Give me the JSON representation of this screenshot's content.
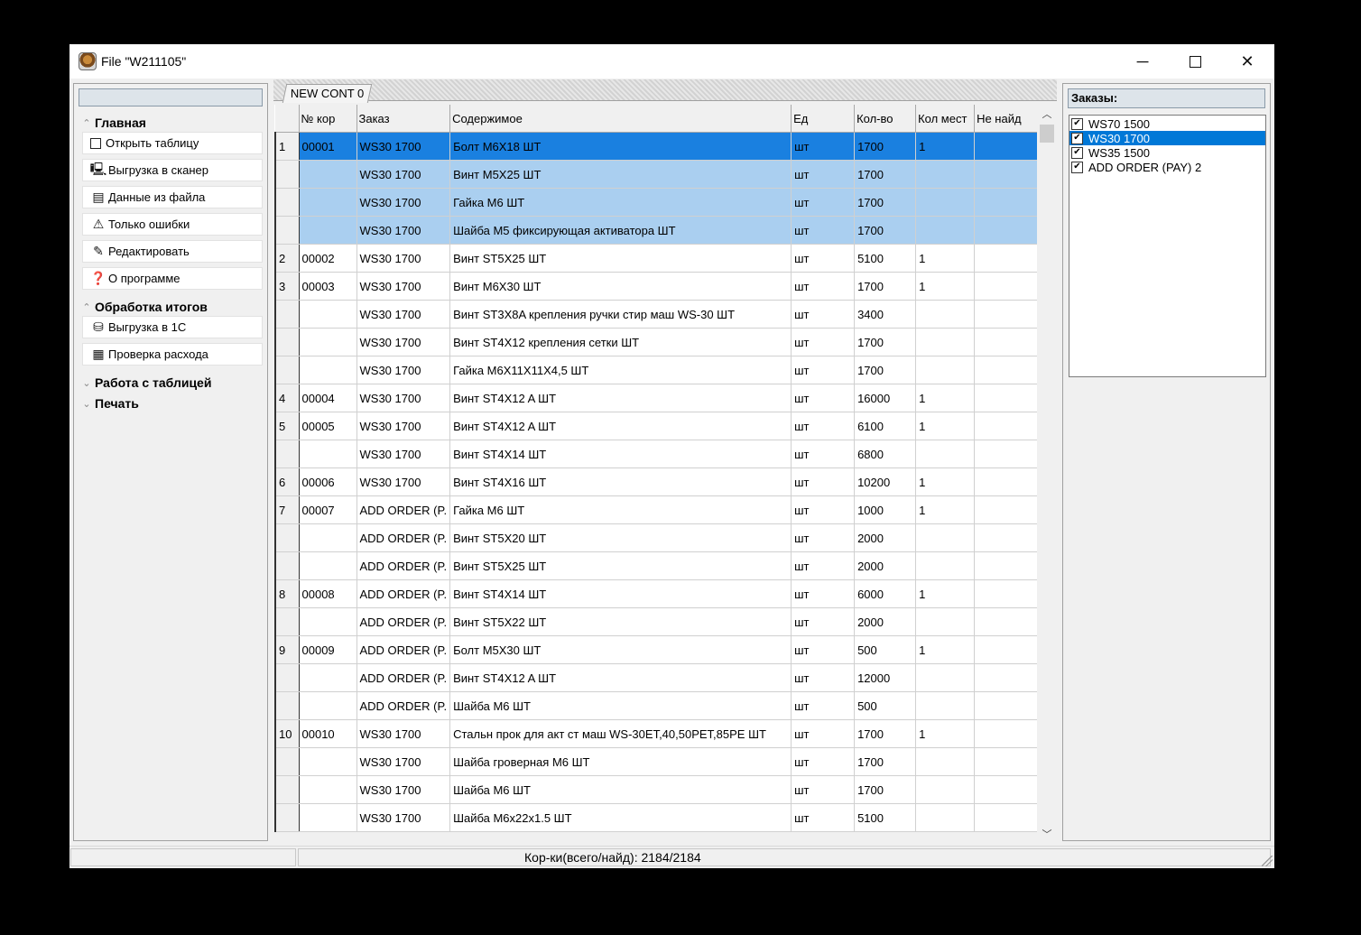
{
  "window": {
    "title": "File \"W211105\""
  },
  "left_panel": {
    "groups": [
      {
        "title": "Главная",
        "expanded": true,
        "items": [
          {
            "label": "Открыть таблицу",
            "icon": "table-open-icon"
          },
          {
            "label": "Выгрузка в сканер",
            "icon": "computer-export-icon"
          },
          {
            "label": "Данные из файла",
            "icon": "file-data-icon"
          },
          {
            "label": "Только ошибки",
            "icon": "warning-icon"
          },
          {
            "label": "Редактировать",
            "icon": "edit-icon"
          },
          {
            "label": "О программе",
            "icon": "help-icon"
          }
        ]
      },
      {
        "title": "Обработка итогов",
        "expanded": true,
        "items": [
          {
            "label": "Выгрузка в 1С",
            "icon": "1c-export-icon"
          },
          {
            "label": "Проверка расхода",
            "icon": "check-expense-icon"
          }
        ]
      },
      {
        "title": "Работа с таблицей",
        "expanded": false,
        "items": []
      },
      {
        "title": "Печать",
        "expanded": false,
        "items": []
      }
    ]
  },
  "grid": {
    "tab_label": "NEW CONT 0",
    "columns": [
      "№ кор",
      "Заказ",
      "Содержимое",
      "Ед",
      "Кол-во",
      "Кол мест",
      "Не найд"
    ],
    "rows": [
      {
        "ind": "1",
        "box": "00001",
        "order": "WS30 1700",
        "content": "Болт М6Х18 ШТ",
        "unit": "шт",
        "qty": "1700",
        "places": "1",
        "nf": "",
        "state": "sel"
      },
      {
        "ind": "",
        "box": "",
        "order": "WS30 1700",
        "content": "Винт М5Х25 ШТ",
        "unit": "шт",
        "qty": "1700",
        "places": "",
        "nf": "",
        "state": "sel2"
      },
      {
        "ind": "",
        "box": "",
        "order": "WS30 1700",
        "content": "Гайка М6 ШТ",
        "unit": "шт",
        "qty": "1700",
        "places": "",
        "nf": "",
        "state": "sel2"
      },
      {
        "ind": "",
        "box": "",
        "order": "WS30 1700",
        "content": "Шайба М5 фиксирующая активатора ШТ",
        "unit": "шт",
        "qty": "1700",
        "places": "",
        "nf": "",
        "state": "sel2"
      },
      {
        "ind": "2",
        "box": "00002",
        "order": "WS30 1700",
        "content": "Винт ST5X25 ШТ",
        "unit": "шт",
        "qty": "5100",
        "places": "1",
        "nf": "",
        "state": ""
      },
      {
        "ind": "3",
        "box": "00003",
        "order": "WS30 1700",
        "content": "Винт М6Х30 ШТ",
        "unit": "шт",
        "qty": "1700",
        "places": "1",
        "nf": "",
        "state": ""
      },
      {
        "ind": "",
        "box": "",
        "order": "WS30 1700",
        "content": "Винт ST3X8A крепления ручки стир маш WS-30 ШТ",
        "unit": "шт",
        "qty": "3400",
        "places": "",
        "nf": "",
        "state": ""
      },
      {
        "ind": "",
        "box": "",
        "order": "WS30 1700",
        "content": "Винт ST4X12 крепления сетки ШТ",
        "unit": "шт",
        "qty": "1700",
        "places": "",
        "nf": "",
        "state": ""
      },
      {
        "ind": "",
        "box": "",
        "order": "WS30 1700",
        "content": "Гайка М6Х11Х11Х4,5 ШТ",
        "unit": "шт",
        "qty": "1700",
        "places": "",
        "nf": "",
        "state": ""
      },
      {
        "ind": "4",
        "box": "00004",
        "order": "WS30 1700",
        "content": "Винт ST4X12 A ШТ",
        "unit": "шт",
        "qty": "16000",
        "places": "1",
        "nf": "",
        "state": ""
      },
      {
        "ind": "5",
        "box": "00005",
        "order": "WS30 1700",
        "content": "Винт ST4X12 A ШТ",
        "unit": "шт",
        "qty": "6100",
        "places": "1",
        "nf": "",
        "state": ""
      },
      {
        "ind": "",
        "box": "",
        "order": "WS30 1700",
        "content": "Винт ST4X14 ШТ",
        "unit": "шт",
        "qty": "6800",
        "places": "",
        "nf": "",
        "state": ""
      },
      {
        "ind": "6",
        "box": "00006",
        "order": "WS30 1700",
        "content": "Винт ST4X16 ШТ",
        "unit": "шт",
        "qty": "10200",
        "places": "1",
        "nf": "",
        "state": ""
      },
      {
        "ind": "7",
        "box": "00007",
        "order": "ADD ORDER (P.",
        "content": "Гайка М6 ШТ",
        "unit": "шт",
        "qty": "1000",
        "places": "1",
        "nf": "",
        "state": ""
      },
      {
        "ind": "",
        "box": "",
        "order": "ADD ORDER (P.",
        "content": "Винт ST5X20 ШТ",
        "unit": "шт",
        "qty": "2000",
        "places": "",
        "nf": "",
        "state": ""
      },
      {
        "ind": "",
        "box": "",
        "order": "ADD ORDER (P.",
        "content": "Винт ST5X25 ШТ",
        "unit": "шт",
        "qty": "2000",
        "places": "",
        "nf": "",
        "state": ""
      },
      {
        "ind": "8",
        "box": "00008",
        "order": "ADD ORDER (P.",
        "content": "Винт ST4X14 ШТ",
        "unit": "шт",
        "qty": "6000",
        "places": "1",
        "nf": "",
        "state": ""
      },
      {
        "ind": "",
        "box": "",
        "order": "ADD ORDER (P.",
        "content": "Винт ST5X22 ШТ",
        "unit": "шт",
        "qty": "2000",
        "places": "",
        "nf": "",
        "state": ""
      },
      {
        "ind": "9",
        "box": "00009",
        "order": "ADD ORDER (P.",
        "content": "Болт М5Х30 ШТ",
        "unit": "шт",
        "qty": "500",
        "places": "1",
        "nf": "",
        "state": ""
      },
      {
        "ind": "",
        "box": "",
        "order": "ADD ORDER (P.",
        "content": "Винт ST4X12 A ШТ",
        "unit": "шт",
        "qty": "12000",
        "places": "",
        "nf": "",
        "state": ""
      },
      {
        "ind": "",
        "box": "",
        "order": "ADD ORDER (P.",
        "content": "Шайба М6 ШТ",
        "unit": "шт",
        "qty": "500",
        "places": "",
        "nf": "",
        "state": ""
      },
      {
        "ind": "10",
        "box": "00010",
        "order": "WS30 1700",
        "content": "Стальн прок для акт ст маш  WS-30ET,40,50PET,85PE ШТ",
        "unit": "шт",
        "qty": "1700",
        "places": "1",
        "nf": "",
        "state": ""
      },
      {
        "ind": "",
        "box": "",
        "order": "WS30 1700",
        "content": "Шайба гроверная М6 ШТ",
        "unit": "шт",
        "qty": "1700",
        "places": "",
        "nf": "",
        "state": ""
      },
      {
        "ind": "",
        "box": "",
        "order": "WS30 1700",
        "content": "Шайба М6 ШТ",
        "unit": "шт",
        "qty": "1700",
        "places": "",
        "nf": "",
        "state": ""
      },
      {
        "ind": "",
        "box": "",
        "order": "WS30 1700",
        "content": "Шайба М6х22х1.5 ШТ",
        "unit": "шт",
        "qty": "5100",
        "places": "",
        "nf": "",
        "state": ""
      }
    ]
  },
  "orders_panel": {
    "title": "Заказы:",
    "items": [
      {
        "label": "WS70 1500",
        "checked": true,
        "selected": false
      },
      {
        "label": "WS30 1700",
        "checked": true,
        "selected": true
      },
      {
        "label": "WS35 1500",
        "checked": true,
        "selected": false
      },
      {
        "label": "ADD ORDER (PAY) 2",
        "checked": true,
        "selected": false
      }
    ]
  },
  "status_bar": {
    "text": "Кор-ки(всего/найд): 2184/2184"
  },
  "colors": {
    "selected_row": "#1a80e0",
    "selected_group": "#aacff0",
    "list_selection": "#0078d7"
  }
}
